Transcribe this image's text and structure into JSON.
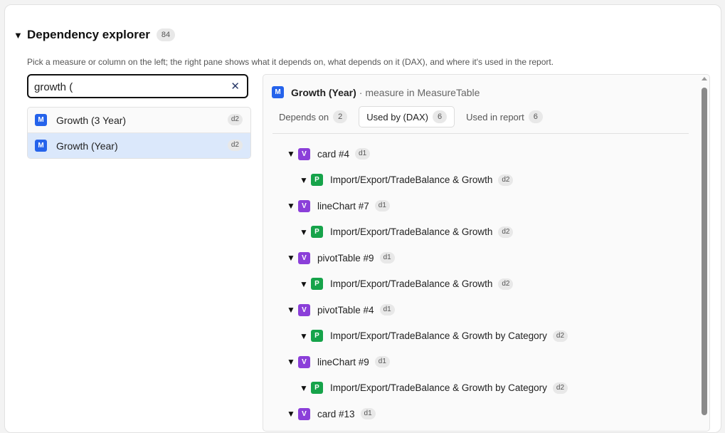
{
  "header": {
    "title": "Dependency explorer",
    "count": "84"
  },
  "description": "Pick a measure or column on the left; the right pane shows what it depends on, what depends on it (DAX), and where it's used in the report.",
  "search": {
    "value": "growth ("
  },
  "results": [
    {
      "type": "M",
      "label": "Growth (3 Year)",
      "depth": "d2",
      "selected": false
    },
    {
      "type": "M",
      "label": "Growth (Year)",
      "depth": "d2",
      "selected": true
    }
  ],
  "detail": {
    "type": "M",
    "title": "Growth (Year)",
    "subtitle": "· measure in MeasureTable",
    "tabs": [
      {
        "label": "Depends on",
        "count": "2",
        "active": false
      },
      {
        "label": "Used by (DAX)",
        "count": "6",
        "active": true
      },
      {
        "label": "Used in report",
        "count": "6",
        "active": false
      }
    ],
    "tree": [
      {
        "type": "V",
        "label": "card #4",
        "depth": "d1",
        "level": 0
      },
      {
        "type": "P",
        "label": "Import/Export/TradeBalance & Growth",
        "depth": "d2",
        "level": 1
      },
      {
        "type": "V",
        "label": "lineChart #7",
        "depth": "d1",
        "level": 0
      },
      {
        "type": "P",
        "label": "Import/Export/TradeBalance & Growth",
        "depth": "d2",
        "level": 1
      },
      {
        "type": "V",
        "label": "pivotTable #9",
        "depth": "d1",
        "level": 0
      },
      {
        "type": "P",
        "label": "Import/Export/TradeBalance & Growth",
        "depth": "d2",
        "level": 1
      },
      {
        "type": "V",
        "label": "pivotTable #4",
        "depth": "d1",
        "level": 0
      },
      {
        "type": "P",
        "label": "Import/Export/TradeBalance & Growth by Category",
        "depth": "d2",
        "level": 1
      },
      {
        "type": "V",
        "label": "lineChart #9",
        "depth": "d1",
        "level": 0
      },
      {
        "type": "P",
        "label": "Import/Export/TradeBalance & Growth by Category",
        "depth": "d2",
        "level": 1
      },
      {
        "type": "V",
        "label": "card #13",
        "depth": "d1",
        "level": 0
      }
    ]
  }
}
